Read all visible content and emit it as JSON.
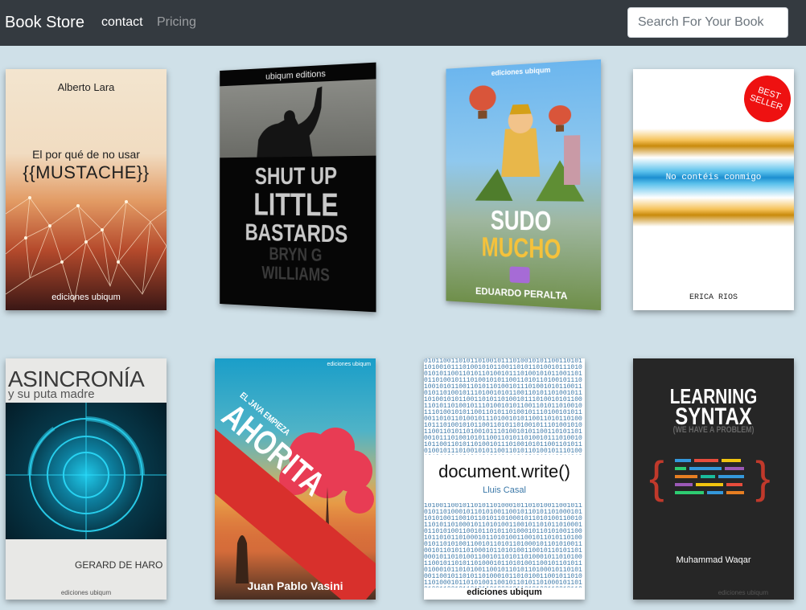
{
  "nav": {
    "brand": "Book Store",
    "links": [
      "contact",
      "Pricing"
    ],
    "search_placeholder": "Search For Your Book"
  },
  "books": [
    {
      "author": "Alberto Lara",
      "title_line1": "El por qué de no usar",
      "title_line2": "{{MUSTACHE}}",
      "publisher": "ediciones ubiqum"
    },
    {
      "publisher": "ubiqum editions",
      "title_lines": [
        "SHUT UP",
        "LITTLE",
        "BASTARDS"
      ],
      "author_lines": [
        "BRYN G",
        "WILLIAMS"
      ]
    },
    {
      "publisher": "ediciones ubiqum",
      "title_lines": [
        "SUDO",
        "MUCHO"
      ],
      "author": "EDUARDO PERALTA"
    },
    {
      "badge_lines": [
        "BEST",
        "SELLER"
      ],
      "title": "No contéis conmigo",
      "author": "ERICA RIOS"
    },
    {
      "title": "ASINCRONÍA",
      "subtitle": "y su puta madre",
      "author": "GERARD DE HARO",
      "publisher": "ediciones ubiqum"
    },
    {
      "publisher": "ediciones ubiqum",
      "title_small": "EL JAVA EMPIEZA",
      "title_big": "AHORITA",
      "author": "Juan Pablo Vasini"
    },
    {
      "title": "document.write()",
      "author": "Lluis Casal",
      "publisher": "ediciones ubiqum"
    },
    {
      "title_lines": [
        "LEARNING",
        "SYNTAX"
      ],
      "subtitle": "(WE HAVE A PROBLEM)",
      "author": "Muhammad Waqar",
      "publisher": "ediciones ubiqum"
    }
  ],
  "colors": {
    "navbar": "#343a40",
    "page_background": "#cfe0e8",
    "badge": "#ee1111"
  }
}
